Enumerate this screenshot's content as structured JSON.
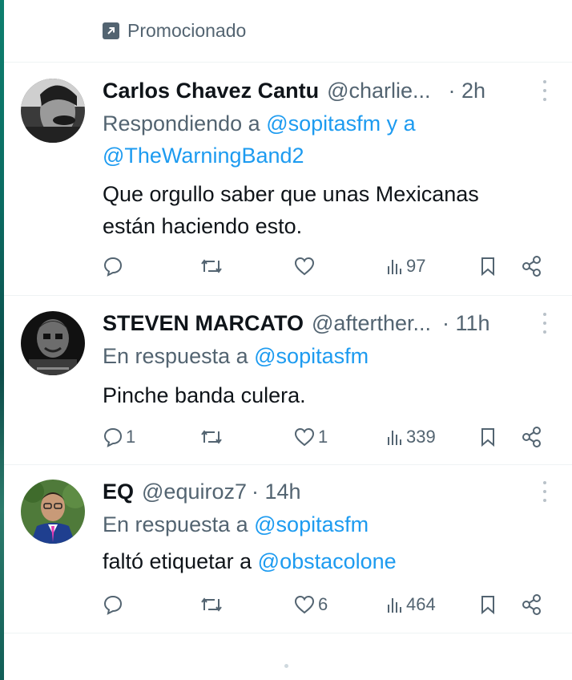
{
  "promo": {
    "label": "Promocionado",
    "icon": "promoted-arrow-icon"
  },
  "tweets": [
    {
      "name": "Carlos Chavez Cantu",
      "handle": "@charlie...",
      "time": "· 2h",
      "reply_prefix": "Respondiendo a",
      "reply_target_1": "@sopitasfm y a",
      "reply_target_2": "@TheWarningBand2",
      "body_line_1": "Que orgullo saber que unas Mexicanas",
      "body_line_2": "están haciendo esto.",
      "replies": "",
      "retweets": "",
      "likes": "",
      "views": "97"
    },
    {
      "name": "STEVEN MARCATO",
      "handle": "@afterther...",
      "time": "· 11h",
      "reply_prefix": "En respuesta a",
      "reply_target": "@sopitasfm",
      "body_line_1": "Pinche banda culera.",
      "replies": "1",
      "retweets": "",
      "likes": "1",
      "views": "339"
    },
    {
      "name": "EQ",
      "handle": "@equiroz7",
      "time": "· 14h",
      "reply_prefix": "En respuesta a",
      "reply_target": "@sopitasfm",
      "body_prefix": "faltó etiquetar a",
      "body_mention": "@obstacolone",
      "replies": "",
      "retweets": "",
      "likes": "6",
      "views": "464"
    }
  ],
  "colors": {
    "link": "#1d9bf0",
    "muted": "#536471",
    "text": "#0f1419",
    "divider": "#eff3f4"
  }
}
